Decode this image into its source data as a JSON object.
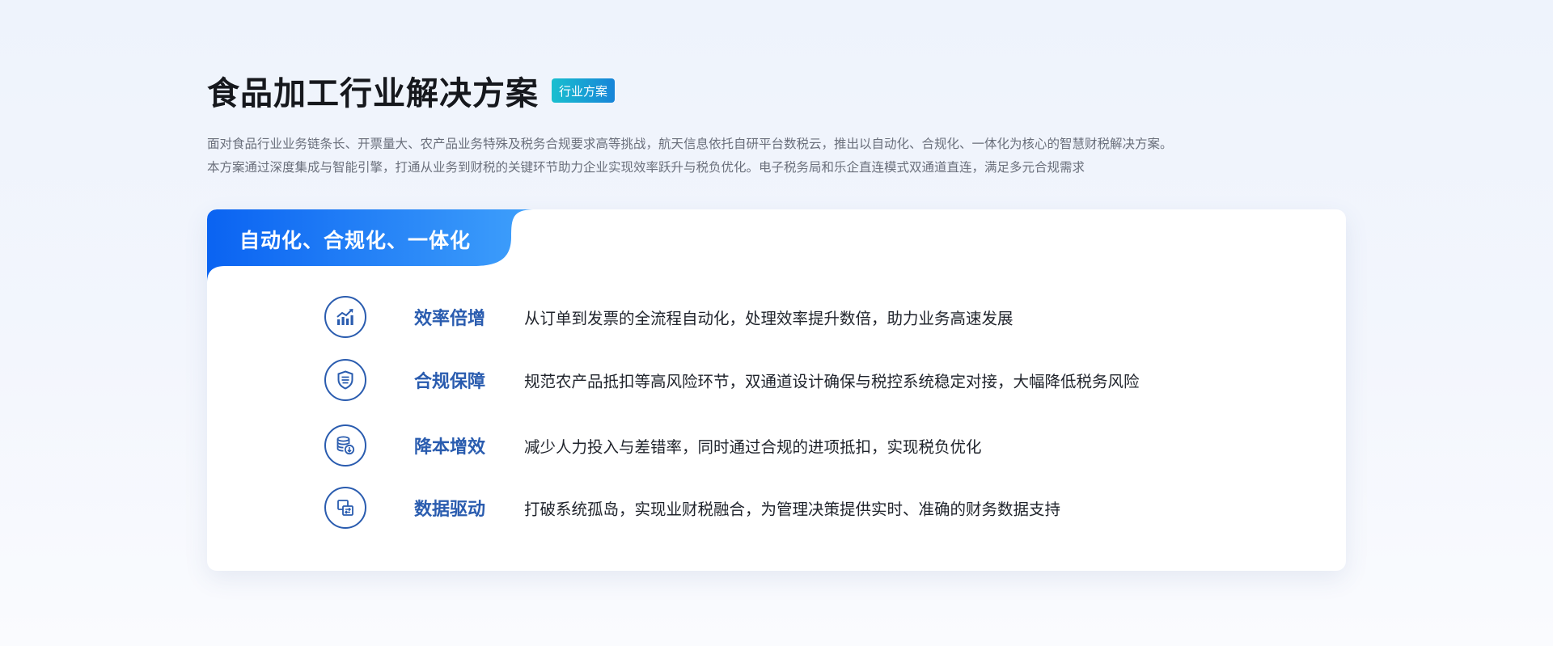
{
  "header": {
    "title": "食品加工行业解决方案",
    "badge": "行业方案",
    "description": [
      "面对食品行业业务链条长、开票量大、农产品业务特殊及税务合规要求高等挑战，航天信息依托自研平台数税云，推出以自动化、合规化、一体化为核心的智慧财税解决方案。",
      "本方案通过深度集成与智能引擎，打通从业务到财税的关键环节助力企业实现效率跃升与税负优化。电子税务局和乐企直连模式双通道直连，满足多元合规需求"
    ]
  },
  "card": {
    "tab_label": "自动化、合规化、一体化",
    "features": [
      {
        "icon": "chart-growth-icon",
        "title": "效率倍增",
        "desc": "从订单到发票的全流程自动化，处理效率提升数倍，助力业务高速发展"
      },
      {
        "icon": "shield-icon",
        "title": "合规保障",
        "desc": "规范农产品抵扣等高风险环节，双通道设计确保与税控系统稳定对接，大幅降低税务风险"
      },
      {
        "icon": "database-icon",
        "title": "降本增效",
        "desc": "减少人力投入与差错率，同时通过合规的进项抵扣，实现税负优化"
      },
      {
        "icon": "data-transfer-icon",
        "title": "数据驱动",
        "desc": "打破系统孤岛，实现业财税融合，为管理决策提供实时、准确的财务数据支持"
      }
    ]
  },
  "colors": {
    "accent": "#2a5caf",
    "tab_gradient_start": "#0a63f2",
    "tab_gradient_end": "#3fa0fb",
    "badge_gradient_start": "#19bfcf",
    "badge_gradient_end": "#1784d8"
  }
}
